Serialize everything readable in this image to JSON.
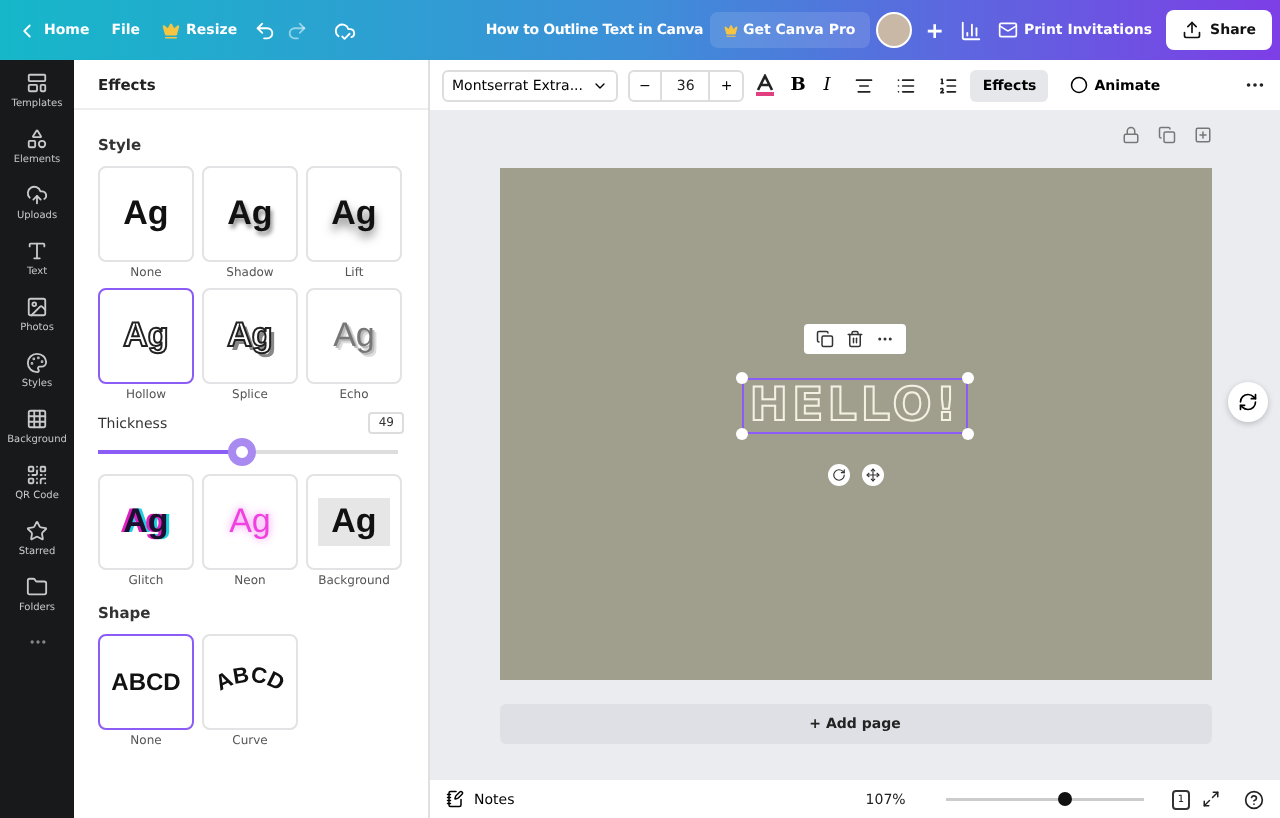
{
  "topbar": {
    "home": "Home",
    "file": "File",
    "resize": "Resize",
    "title": "How to Outline Text in Canva",
    "pro": "Get Canva Pro",
    "plus": "+",
    "print": "Print Invitations",
    "share": "Share"
  },
  "rail": [
    {
      "label": "Templates"
    },
    {
      "label": "Elements"
    },
    {
      "label": "Uploads"
    },
    {
      "label": "Text"
    },
    {
      "label": "Photos"
    },
    {
      "label": "Styles"
    },
    {
      "label": "Background"
    },
    {
      "label": "QR Code"
    },
    {
      "label": "Starred"
    },
    {
      "label": "Folders"
    }
  ],
  "panel": {
    "title": "Effects",
    "style_heading": "Style",
    "styles": [
      {
        "kind": "none",
        "sample": "Ag",
        "label": "None",
        "selected": false
      },
      {
        "kind": "shadow",
        "sample": "Ag",
        "label": "Shadow",
        "selected": false
      },
      {
        "kind": "lift",
        "sample": "Ag",
        "label": "Lift",
        "selected": false
      },
      {
        "kind": "hollow",
        "sample": "Ag",
        "label": "Hollow",
        "selected": true
      },
      {
        "kind": "splice",
        "sample": "Ag",
        "label": "Splice",
        "selected": false
      },
      {
        "kind": "echo",
        "sample": "Ag",
        "label": "Echo",
        "selected": false
      }
    ],
    "thickness": {
      "label": "Thickness",
      "value": "49",
      "level": 0.48
    },
    "more_styles": [
      {
        "kind": "glitch",
        "sample": "Ag",
        "label": "Glitch",
        "selected": false
      },
      {
        "kind": "neon",
        "sample": "Ag",
        "label": "Neon",
        "selected": false
      },
      {
        "kind": "background",
        "sample": "Ag",
        "label": "Background",
        "selected": false
      }
    ],
    "shape_heading": "Shape",
    "shapes": [
      {
        "kind": "none",
        "sample": "ABCD",
        "label": "None",
        "selected": true
      },
      {
        "kind": "curve",
        "sample": "ABCD",
        "label": "Curve",
        "selected": false
      }
    ]
  },
  "toolbar": {
    "font": "Montserrat Extra...",
    "minus": "−",
    "size": "36",
    "plus": "+",
    "bold": "B",
    "italic": "I",
    "effects": {
      "label": "Effects",
      "selected": true
    },
    "animate": "Animate"
  },
  "canvas": {
    "text": "HELLO!",
    "add_page": "+ Add page"
  },
  "bottom": {
    "notes": "Notes",
    "zoom": "107%",
    "zoom_slider": {
      "level": 0.6
    },
    "page_number": "1"
  }
}
